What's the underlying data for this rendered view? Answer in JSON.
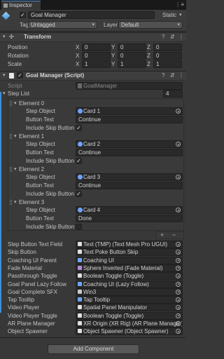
{
  "tab": {
    "title": "Inspector"
  },
  "gameobject": {
    "name": "Goal Manager",
    "static_label": "Static",
    "tag_label": "Tag",
    "tag_value": "Untagged",
    "layer_label": "Layer",
    "layer_value": "Default"
  },
  "transform": {
    "title": "Transform",
    "rows": [
      {
        "label": "Position",
        "x": "0",
        "y": "0",
        "z": "0"
      },
      {
        "label": "Rotation",
        "x": "0",
        "y": "0",
        "z": "0"
      },
      {
        "label": "Scale",
        "x": "1",
        "y": "1",
        "z": "1"
      }
    ],
    "axes": [
      "X",
      "Y",
      "Z"
    ]
  },
  "script_component": {
    "title": "Goal Manager (Script)",
    "script_label": "Script",
    "script_value": "GoalManager",
    "step_list_label": "Step List",
    "step_list_count": "4",
    "elements": [
      {
        "label": "Element 0",
        "step_object_label": "Step Object",
        "step_object": "Card 1",
        "button_text_label": "Button Text",
        "button_text": "Continue",
        "skip_label": "Include Skip Button",
        "skip_checked": true
      },
      {
        "label": "Element 1",
        "step_object_label": "Step Object",
        "step_object": "Card 2",
        "button_text_label": "Button Text",
        "button_text": "Continue",
        "skip_label": "Include Skip Button",
        "skip_checked": true
      },
      {
        "label": "Element 2",
        "step_object_label": "Step Object",
        "step_object": "Card 3",
        "button_text_label": "Button Text",
        "button_text": "Continue",
        "skip_label": "Include Skip Button",
        "skip_checked": true
      },
      {
        "label": "Element 3",
        "step_object_label": "Step Object",
        "step_object": "Card 4",
        "button_text_label": "Button Text",
        "button_text": "Done",
        "skip_label": "Include Skip Button",
        "skip_checked": false
      }
    ],
    "list_add": "+",
    "list_remove": "−",
    "fields": [
      {
        "label": "Step Button Text Field",
        "value": "Text (TMP) (Text Mesh Pro UGUI)"
      },
      {
        "label": "Skip Button",
        "value": "Text Poke Button Skip"
      },
      {
        "label": "Coaching UI Parent",
        "value": "Coaching UI"
      },
      {
        "label": "Fade Material",
        "value": "Sphere Inverted (Fade Material)"
      },
      {
        "label": "Passthrough Toggle",
        "value": "Boolean Toggle (Toggle)"
      },
      {
        "label": "Goal Panel Lazy Follow",
        "value": "Coaching UI (Lazy Follow)"
      },
      {
        "label": "Goal Complete SFX",
        "value": "Win3"
      },
      {
        "label": "Tap Tooltip",
        "value": "Tap Tooltip"
      },
      {
        "label": "Video Player",
        "value": "Spatial Panel Manipulator"
      },
      {
        "label": "Video Player Toggle",
        "value": "Boolean Toggle (Toggle)"
      },
      {
        "label": "AR Plane Manager",
        "value": "XR Origin (XR Rig) (AR Plane Manager)"
      },
      {
        "label": "Object Spawner",
        "value": "Object Spawner (Object Spawner)"
      }
    ]
  },
  "add_component": "Add Component",
  "colors": {
    "accent": "#3d8fd8",
    "bg": "#383838",
    "field": "#2a2a2a"
  }
}
